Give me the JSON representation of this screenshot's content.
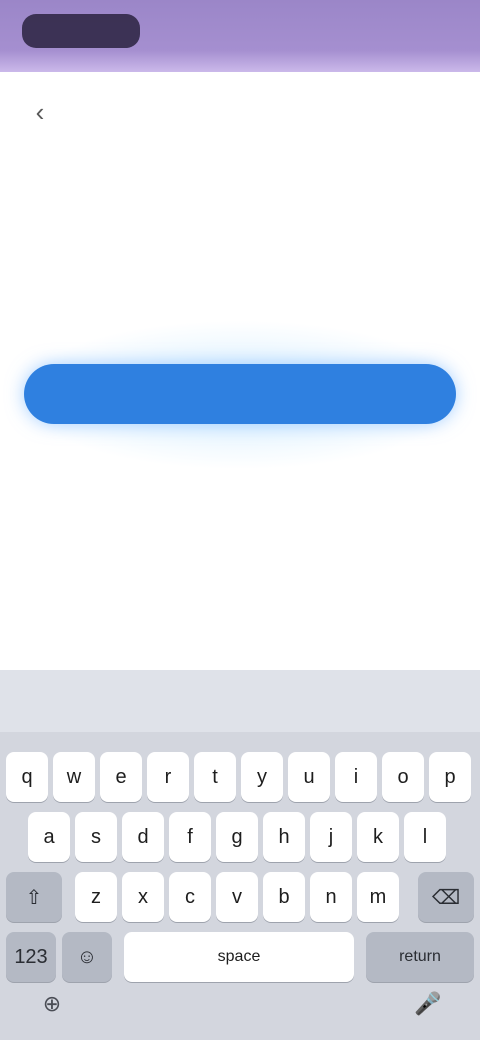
{
  "header": {
    "title": "",
    "back_icon": "back-arrow-icon"
  },
  "content": {
    "description_line1": "",
    "description_line2": "",
    "primary_button_label": "",
    "secondary_link": ""
  },
  "keyboard": {
    "suggestions": [
      "",
      "",
      ""
    ],
    "row1": [
      "q",
      "w",
      "e",
      "r",
      "t",
      "y",
      "u",
      "i",
      "o",
      "p"
    ],
    "row2": [
      "a",
      "s",
      "d",
      "f",
      "g",
      "h",
      "j",
      "k",
      "l"
    ],
    "row3": [
      "z",
      "x",
      "c",
      "v",
      "b",
      "n",
      "m"
    ],
    "shift_icon": "shift-icon",
    "backspace_icon": "backspace-icon",
    "numbers_label": "123",
    "emoji_icon": "emoji-icon",
    "space_label": "space",
    "return_label": "return",
    "globe_icon": "globe-icon",
    "mic_icon": "mic-icon"
  },
  "colors": {
    "status_bar": "#a58fd0",
    "primary": "#2f80e0",
    "keyboard_bg": "#d3d6de"
  }
}
